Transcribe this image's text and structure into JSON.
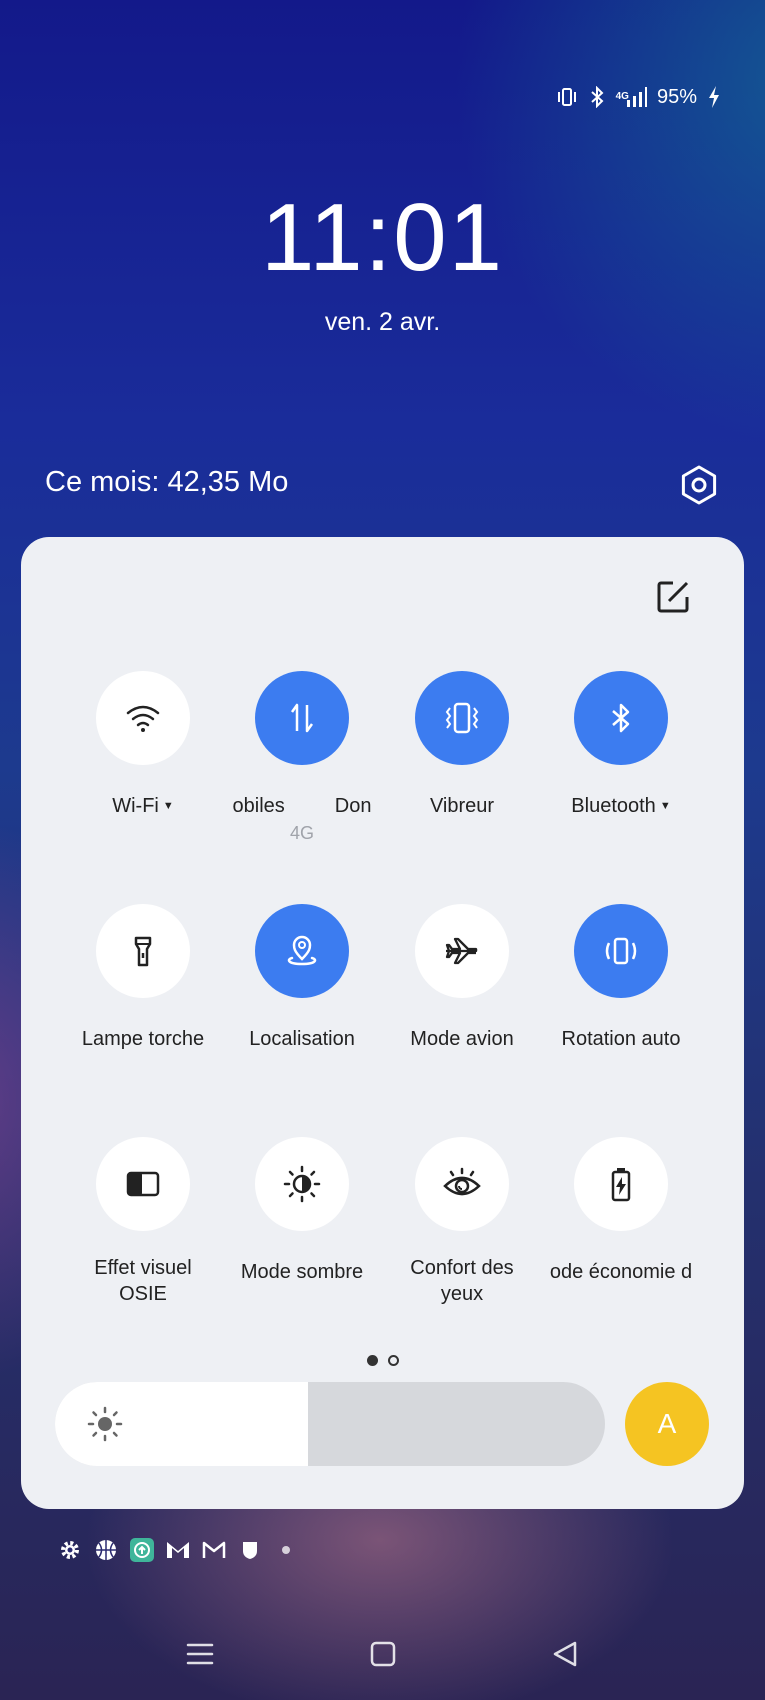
{
  "status_bar": {
    "network_type": "4G",
    "battery_level": "95%",
    "icons": [
      "vibrate-icon",
      "bluetooth-icon",
      "signal-icon",
      "charging-icon"
    ]
  },
  "lockscreen": {
    "time": "11:01",
    "date": "ven. 2 avr."
  },
  "data_usage": "Ce mois: 42,35 Mo",
  "quick_settings": {
    "tiles": [
      {
        "label": "Wi-Fi",
        "active": false,
        "icon": "wifi-icon",
        "has_dropdown": true
      },
      {
        "label": "Données mobiles",
        "visible_label": "obiles         Don",
        "sub": "4G",
        "active": true,
        "icon": "mobile-data-icon"
      },
      {
        "label": "Vibreur",
        "active": true,
        "icon": "vibrate-icon"
      },
      {
        "label": "Bluetooth",
        "active": true,
        "icon": "bluetooth-icon",
        "has_dropdown": true
      },
      {
        "label": "Lampe torche",
        "active": false,
        "icon": "flashlight-icon"
      },
      {
        "label": "Localisation",
        "active": true,
        "icon": "location-icon"
      },
      {
        "label": "Mode avion",
        "active": false,
        "icon": "airplane-icon"
      },
      {
        "label": "Rotation auto",
        "active": true,
        "icon": "auto-rotate-icon"
      },
      {
        "label": "Effet visuel OSIE",
        "line1": "Effet visuel",
        "line2": "OSIE",
        "active": false,
        "icon": "osie-icon"
      },
      {
        "label": "Mode sombre",
        "active": false,
        "icon": "dark-mode-icon"
      },
      {
        "label": "Confort des yeux",
        "line1": "Confort des",
        "line2": "yeux",
        "active": false,
        "icon": "eye-comfort-icon"
      },
      {
        "label": "Mode économie d'énergie",
        "visible_label": "ode économie d",
        "active": false,
        "icon": "battery-saver-icon"
      }
    ],
    "page_indicator": {
      "current": 1,
      "total": 2
    },
    "brightness": {
      "level": 0.46,
      "auto_label": "A"
    }
  },
  "notification_icons": [
    "settings-icon",
    "basketball-icon",
    "app-update-icon",
    "gmail-icon",
    "gmail-outline-icon",
    "shield-icon",
    "more-dot-icon"
  ],
  "nav_bar": [
    "recents-button",
    "home-button",
    "back-button"
  ],
  "colors": {
    "accent": "#3c7cf0",
    "auto_brightness": "#f5c422",
    "panel": "#eef0f4"
  }
}
